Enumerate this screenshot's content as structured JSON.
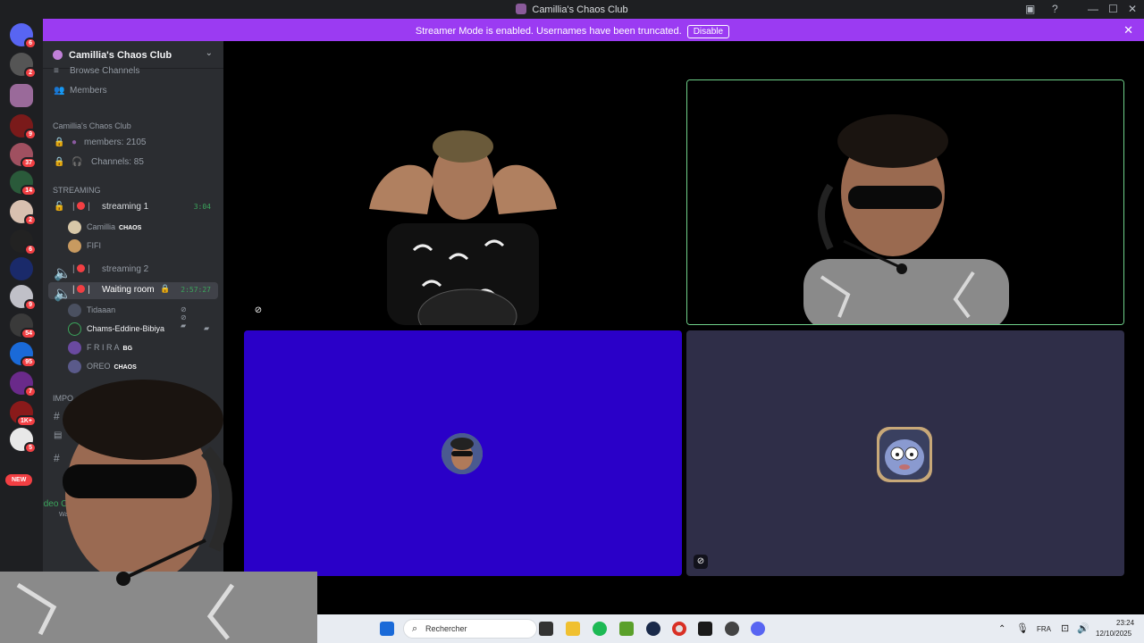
{
  "window": {
    "title": "Camillia's Chaos Club",
    "controls": [
      "minimize",
      "maximize",
      "close"
    ]
  },
  "banner": {
    "message": "Streamer Mode is enabled. Usernames have been truncated.",
    "action_label": "Disable"
  },
  "server_list": {
    "badges": [
      "6",
      "2",
      "9",
      "37",
      "14",
      "2",
      "6",
      "9",
      "54",
      "95",
      "7",
      "1K+",
      "5"
    ],
    "new_label": "NEW"
  },
  "sidebar": {
    "server_name": "Camillia's Chaos Club",
    "browse_channels": "Browse Channels",
    "members": "Members",
    "stats_category": "Camillia's Chaos Club",
    "members_count": "members: 2105",
    "channels_count": "Channels: 85",
    "streaming_category": "STREAMING",
    "voice_channels": [
      {
        "name": "streaming 1",
        "timer": "3:04"
      },
      {
        "name": "streaming 2",
        "timer": ""
      },
      {
        "name": "Waiting room",
        "timer": "2:57:27"
      }
    ],
    "streaming1_users": [
      {
        "name": "Camillia",
        "tag": "CHAOS"
      },
      {
        "name": "FIFI",
        "tag": ""
      }
    ],
    "waiting_users": [
      {
        "name": "Tidaaan",
        "tag": ""
      },
      {
        "name": "Chams-Eddine-Bibiya",
        "tag": ""
      },
      {
        "name": "F R I R A",
        "tag": "BG"
      },
      {
        "name": "OREO",
        "tag": "CHAOS"
      }
    ],
    "partial_category": "IMPO",
    "voice_status": "Video C",
    "voice_status_sub": "Waiti"
  },
  "taskbar": {
    "search_placeholder": "Rechercher",
    "language": "FRA",
    "time": "23:24",
    "date": "12/10/2025"
  },
  "colors": {
    "banner": "#9b3bf2",
    "tile_blue": "#2a00c8",
    "tile_slate": "#2f2e48",
    "speaking_border": "#6fd18a",
    "sidebar_bg": "#2b2d31",
    "server_bg": "#1e1f22"
  }
}
